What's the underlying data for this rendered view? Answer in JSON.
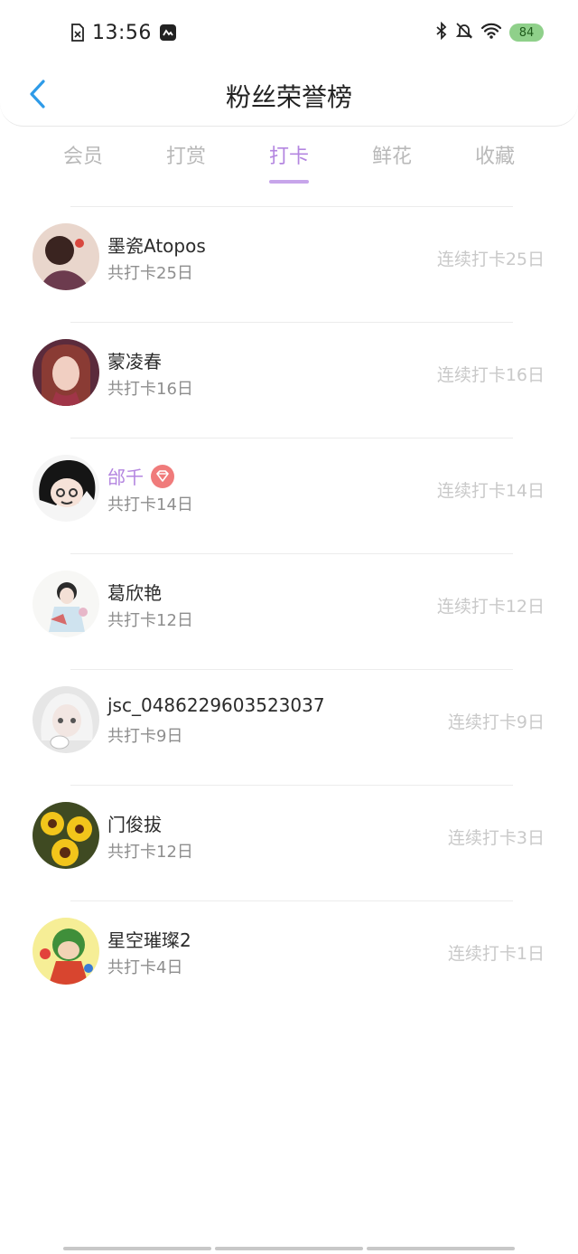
{
  "status_bar": {
    "time": "13:56",
    "battery": "84",
    "icons": [
      "sim-off-icon",
      "app-notification-icon",
      "bluetooth-icon",
      "mute-bell-icon",
      "wifi-icon",
      "battery-icon"
    ]
  },
  "header": {
    "title": "粉丝荣誉榜",
    "back_icon": "chevron-left-icon"
  },
  "tabs": [
    {
      "label": "会员",
      "active": false
    },
    {
      "label": "打赏",
      "active": false
    },
    {
      "label": "打卡",
      "active": true
    },
    {
      "label": "鲜花",
      "active": false
    },
    {
      "label": "收藏",
      "active": false
    }
  ],
  "colors": {
    "accent": "#b486e0",
    "back": "#2e9be8",
    "muted": "#c9c9c9"
  },
  "fans": [
    {
      "name": "墨瓷Atopos",
      "total": "共打卡25日",
      "streak": "连续打卡25日",
      "vip": false
    },
    {
      "name": "蒙凌春",
      "total": "共打卡16日",
      "streak": "连续打卡16日",
      "vip": false
    },
    {
      "name": "邰千",
      "total": "共打卡14日",
      "streak": "连续打卡14日",
      "vip": true
    },
    {
      "name": "葛欣艳",
      "total": "共打卡12日",
      "streak": "连续打卡12日",
      "vip": false
    },
    {
      "name": "jsc_0486229603523037",
      "total": "共打卡9日",
      "streak": "连续打卡9日",
      "vip": false
    },
    {
      "name": "门俊拔",
      "total": "共打卡12日",
      "streak": "连续打卡3日",
      "vip": false
    },
    {
      "name": "星空璀璨2",
      "total": "共打卡4日",
      "streak": "连续打卡1日",
      "vip": false
    }
  ]
}
